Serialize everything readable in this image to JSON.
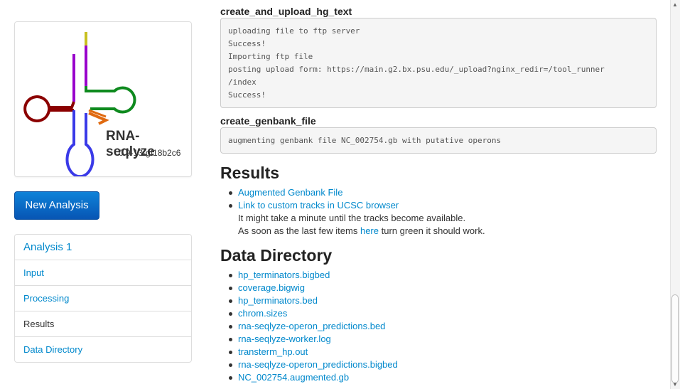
{
  "sidebar": {
    "app_name": "RNA-seqlyze",
    "app_version": "0.9-13-gf18b2c6",
    "new_analysis_label": "New Analysis",
    "nav": [
      {
        "label": "Analysis 1"
      },
      {
        "label": "Input"
      },
      {
        "label": "Processing"
      },
      {
        "label": "Results"
      },
      {
        "label": "Data Directory"
      }
    ]
  },
  "log": {
    "section1_title": "create_and_upload_hg_text",
    "section1_lines": [
      "uploading file to ftp server",
      "Success!",
      "Importing ftp file",
      "posting upload form: https://main.g2.bx.psu.edu/_upload?nginx_redir=/tool_runner",
      "/index",
      "Success!"
    ],
    "section2_title": "create_genbank_file",
    "section2_lines": [
      "augmenting genbank file NC_002754.gb with putative operons"
    ]
  },
  "results": {
    "title": "Results",
    "links": [
      "Augmented Genbank File",
      "Link to custom tracks in UCSC browser"
    ],
    "note1": "It might take a minute until the tracks become available.",
    "note2_before": "As soon as the last few items ",
    "note2_link": "here",
    "note2_after": " turn green it should work."
  },
  "data_directory": {
    "title": "Data Directory",
    "files": [
      "hp_terminators.bigbed",
      "coverage.bigwig",
      "hp_terminators.bed",
      "chrom.sizes",
      "rna-seqlyze-operon_predictions.bed",
      "rna-seqlyze-worker.log",
      "transterm_hp.out",
      "rna-seqlyze-operon_predictions.bigbed",
      "NC_002754.augmented.gb"
    ]
  },
  "colors": {
    "link": "#0088cc",
    "button": "#0a6fd0",
    "logo_dark_red": "#8b0000",
    "logo_purple": "#9900cc",
    "logo_green": "#0e8a1e",
    "logo_orange": "#e06a10",
    "logo_blue": "#3a3ae8",
    "logo_yellow": "#c8c020"
  }
}
